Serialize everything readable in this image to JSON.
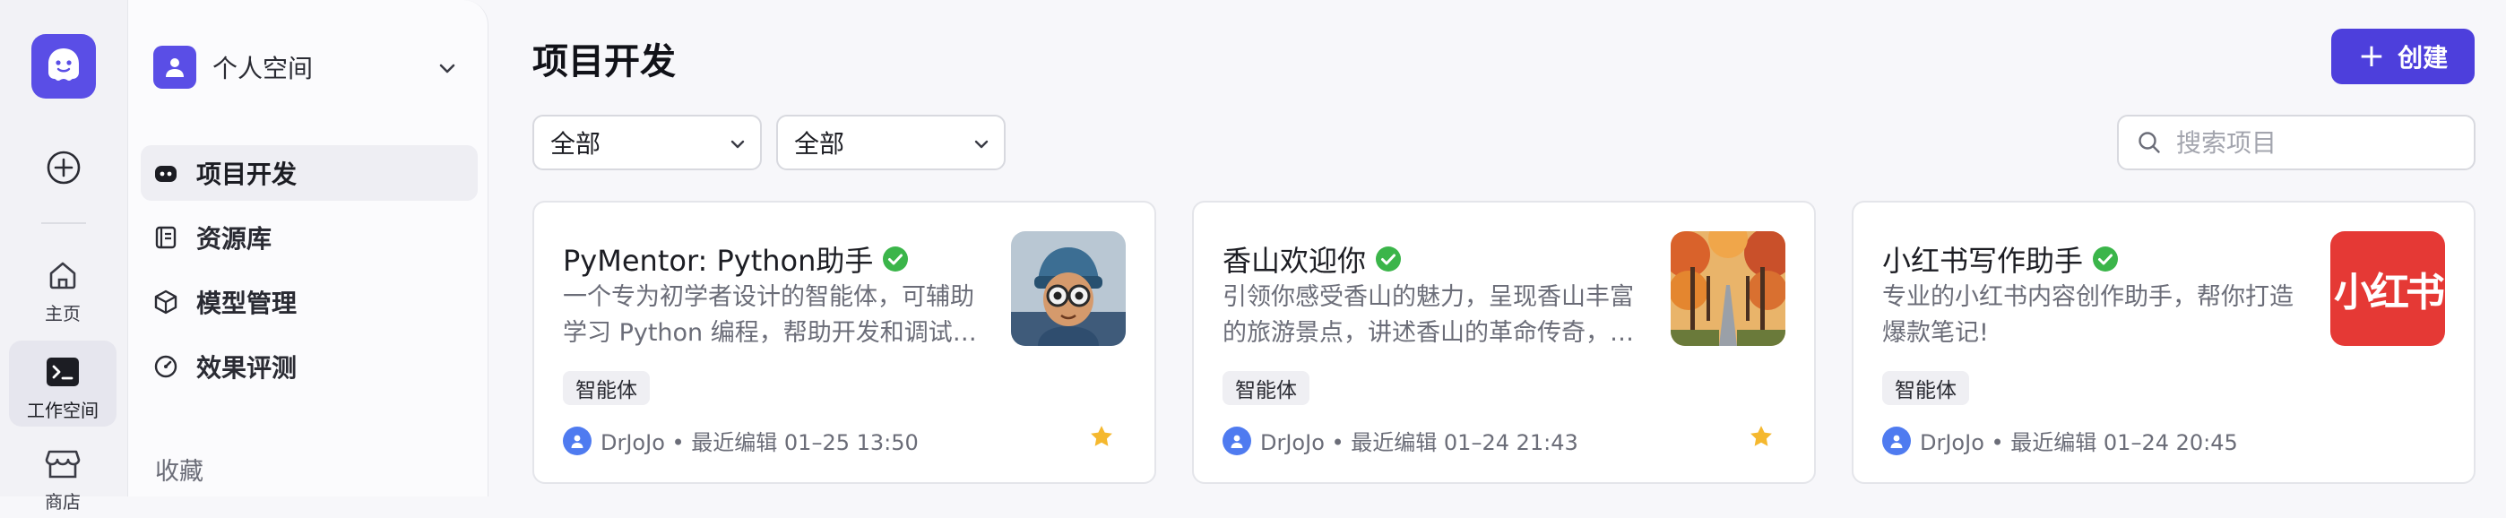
{
  "rail": {
    "items": [
      {
        "label": "主页",
        "icon": "home-icon"
      },
      {
        "label": "工作空间",
        "icon": "terminal-icon"
      },
      {
        "label": "商店",
        "icon": "store-icon"
      }
    ]
  },
  "sidebar": {
    "space_name": "个人空间",
    "nav": [
      {
        "label": "项目开发",
        "icon": "bot-icon"
      },
      {
        "label": "资源库",
        "icon": "book-icon"
      },
      {
        "label": "模型管理",
        "icon": "cube-icon"
      },
      {
        "label": "效果评测",
        "icon": "gauge-icon"
      }
    ],
    "section_label": "收藏"
  },
  "main": {
    "title": "项目开发",
    "create_label": "创建",
    "filter_type": "全部",
    "filter_status": "全部",
    "search_placeholder": "搜索项目"
  },
  "colors": {
    "accent": "#4d3fdc",
    "verified": "#3bb54a",
    "star": "#f5b82e",
    "rednote": "#e53935"
  },
  "cards": [
    {
      "title": "PyMentor: Python助手",
      "desc_line1": "一个专为初学者设计的智能体，可辅助",
      "desc_line2": "学习 Python 编程，帮助开发和调试代码",
      "tag": "智能体",
      "meta": "DrJoJo • 最近编辑 01–25 13:50",
      "starred": true
    },
    {
      "title": "香山欢迎你",
      "desc_line1": "引领你感受香山的魅力，呈现香山丰富",
      "desc_line2": "的旅游景点，讲述香山的革命传奇，推荐",
      "tag": "智能体",
      "meta": "DrJoJo • 最近编辑 01–24 21:43",
      "starred": true
    },
    {
      "title": "小红书写作助手",
      "desc_line1": "专业的小红书内容创作助手，帮你打造",
      "desc_line2": "爆款笔记!",
      "tag": "智能体",
      "meta": "DrJoJo • 最近编辑 01–24 20:45",
      "thumb_text": "小红书",
      "starred": false
    }
  ]
}
